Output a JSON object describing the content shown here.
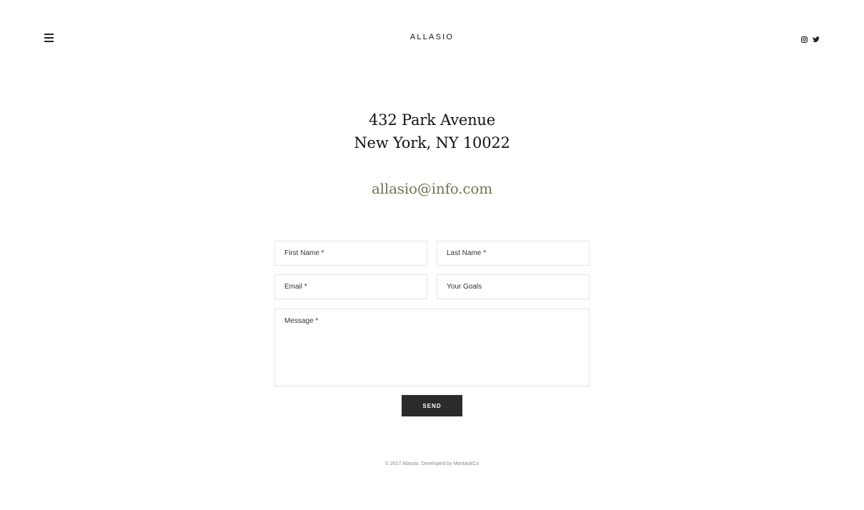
{
  "header": {
    "logo": "ALLASIO",
    "menu_icon": "hamburger-menu-icon",
    "social": [
      {
        "name": "instagram-icon"
      },
      {
        "name": "twitter-icon"
      }
    ]
  },
  "contact": {
    "address_line1": "432 Park Avenue",
    "address_line2": "New York, NY 10022",
    "email": "allasio@info.com",
    "accent_color": "#6f7550"
  },
  "form": {
    "first_name_placeholder": "First Name *",
    "last_name_placeholder": "Last Name *",
    "email_placeholder": "Email *",
    "goals_placeholder": "Your Goals",
    "message_placeholder": "Message *",
    "send_label": "SEND"
  },
  "footer": {
    "text": "© 2017 Alassio. Developed by MontaukCo"
  }
}
